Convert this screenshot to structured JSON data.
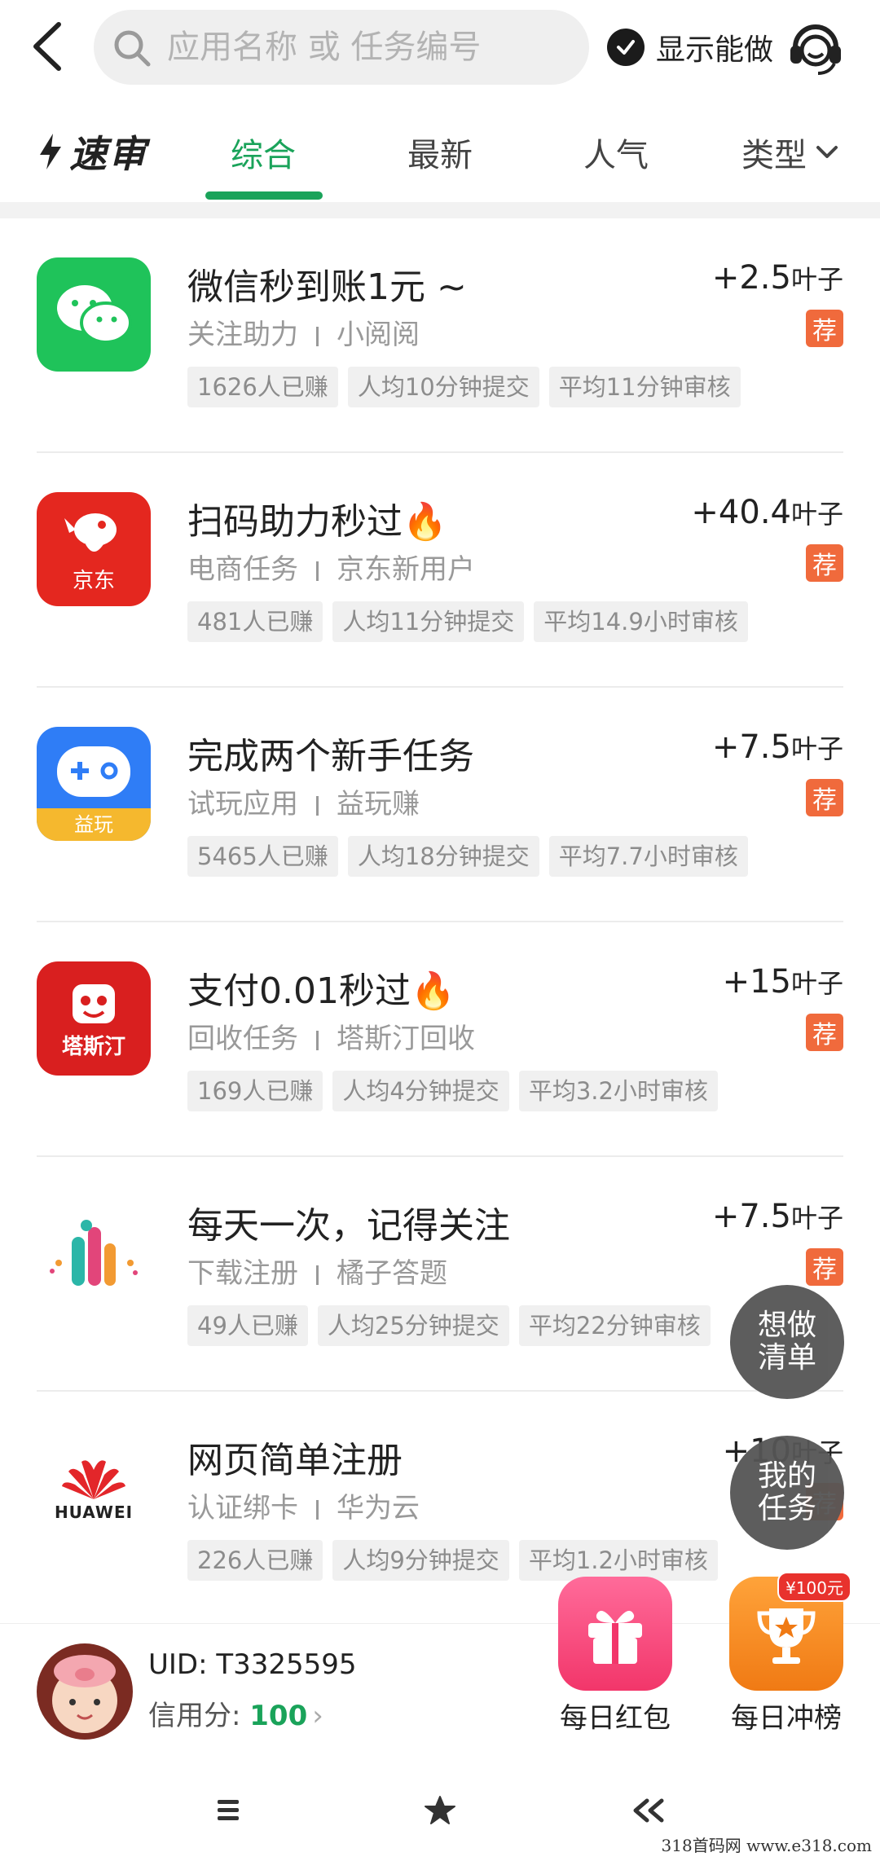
{
  "search": {
    "placeholder": "应用名称 或 任务编号"
  },
  "header": {
    "show_can_do": "显示能做"
  },
  "tabs": {
    "brand": "速审",
    "items": [
      "综合",
      "最新",
      "人气"
    ],
    "type_label": "类型"
  },
  "tasks": [
    {
      "title": "微信秒到账1元 ~",
      "reward": "+2.5",
      "unit": "叶子",
      "category": "关注助力",
      "app": "小阅阅",
      "rec": "荐",
      "tags": [
        "1626人已赚",
        "人均10分钟提交",
        "平均11分钟审核"
      ]
    },
    {
      "title": "扫码助力秒过🔥",
      "reward": "+40.4",
      "unit": "叶子",
      "category": "电商任务",
      "app": "京东新用户",
      "rec": "荐",
      "logo_text": "京东",
      "tags": [
        "481人已赚",
        "人均11分钟提交",
        "平均14.9小时审核"
      ]
    },
    {
      "title": "完成两个新手任务",
      "reward": "+7.5",
      "unit": "叶子",
      "category": "试玩应用",
      "app": "益玩赚",
      "rec": "荐",
      "logo_text": "益玩",
      "tags": [
        "5465人已赚",
        "人均18分钟提交",
        "平均7.7小时审核"
      ]
    },
    {
      "title": "支付0.01秒过🔥",
      "reward": "+15",
      "unit": "叶子",
      "category": "回收任务",
      "app": "塔斯汀回收",
      "rec": "荐",
      "logo_text": "塔斯汀",
      "tags": [
        "169人已赚",
        "人均4分钟提交",
        "平均3.2小时审核"
      ]
    },
    {
      "title": "每天一次，记得关注",
      "reward": "+7.5",
      "unit": "叶子",
      "category": "下载注册",
      "app": "橘子答题",
      "rec": "荐",
      "tags": [
        "49人已赚",
        "人均25分钟提交",
        "平均22分钟审核"
      ]
    },
    {
      "title": "网页简单注册",
      "reward": "+10",
      "unit": "叶子",
      "category": "认证绑卡",
      "app": "华为云",
      "rec": "荐",
      "logo_text": "HUAWEI",
      "tags": [
        "226人已赚",
        "人均9分钟提交",
        "平均1.2小时审核"
      ]
    }
  ],
  "floating": {
    "wish_list": [
      "想做",
      "清单"
    ],
    "my_tasks": [
      "我的",
      "任务"
    ]
  },
  "user": {
    "uid": "UID: T3325595",
    "credit_label": "信用分: ",
    "credit_score": "100"
  },
  "daily": {
    "red_packet": "每日红包",
    "rank": "每日冲榜",
    "rank_badge": "¥100元"
  },
  "watermark": "318首码网  www.e318.com",
  "colors": {
    "accent": "#1aa35a",
    "rec": "#f06a3c"
  }
}
